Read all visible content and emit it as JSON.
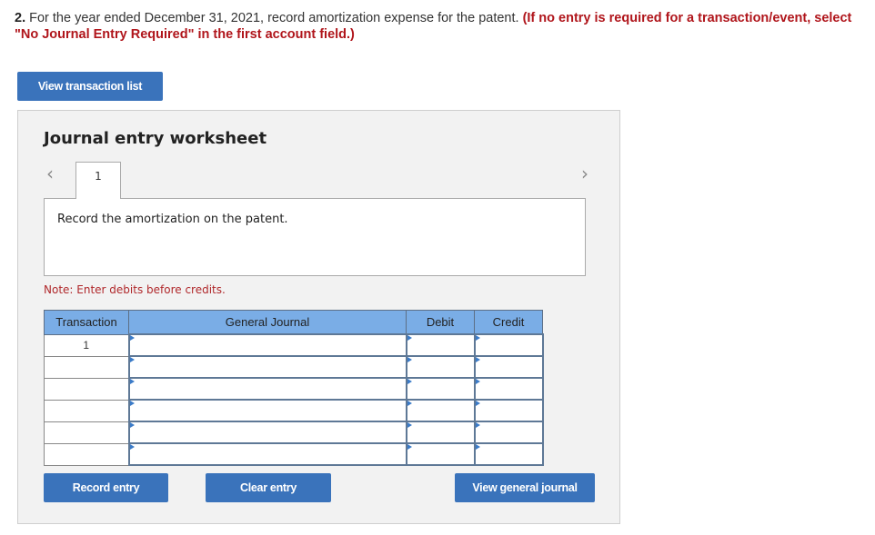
{
  "question": {
    "number": "2.",
    "text": " For the year ended December 31, 2021, record amortization expense for the patent. ",
    "instruction": "(If no entry is required for a transaction/event, select \"No Journal Entry Required\" in the first account field.)"
  },
  "buttons": {
    "view_transaction_list": "View transaction list",
    "record_entry": "Record entry",
    "clear_entry": "Clear entry",
    "view_general_journal": "View general journal"
  },
  "worksheet": {
    "title": "Journal entry worksheet",
    "nav_prev_icon": "chevron-left-icon",
    "nav_next_icon": "chevron-right-icon",
    "tabs": [
      {
        "label": "1"
      }
    ],
    "description": "Record the amortization on the patent.",
    "note": "Note: Enter debits before credits.",
    "table": {
      "headers": [
        "Transaction",
        "General Journal",
        "Debit",
        "Credit"
      ],
      "rows": [
        {
          "transaction": "1",
          "account": "",
          "debit": "",
          "credit": ""
        },
        {
          "transaction": "",
          "account": "",
          "debit": "",
          "credit": ""
        },
        {
          "transaction": "",
          "account": "",
          "debit": "",
          "credit": ""
        },
        {
          "transaction": "",
          "account": "",
          "debit": "",
          "credit": ""
        },
        {
          "transaction": "",
          "account": "",
          "debit": "",
          "credit": ""
        },
        {
          "transaction": "",
          "account": "",
          "debit": "",
          "credit": ""
        }
      ]
    }
  },
  "colors": {
    "button": "#3a73bb",
    "instruction_red": "#b0151b",
    "header_blue": "#7aade6"
  }
}
